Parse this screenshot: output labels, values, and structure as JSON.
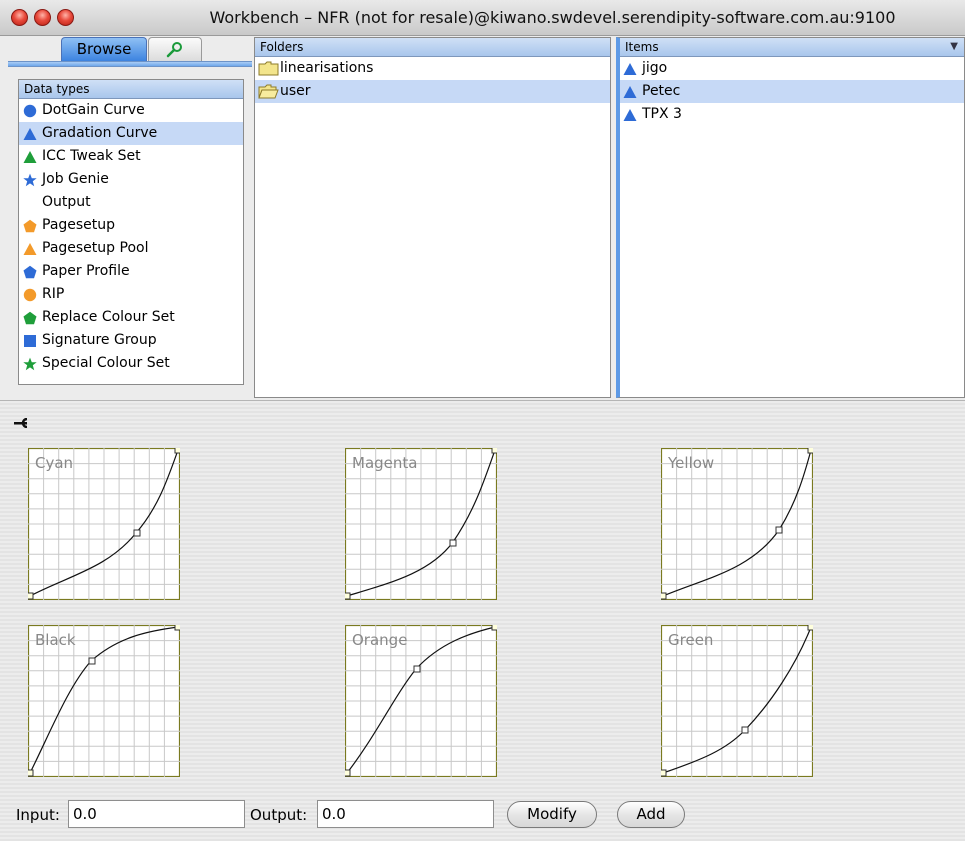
{
  "window": {
    "title": "Workbench – NFR (not for resale)@kiwano.swdevel.serendipity-software.com.au:9100"
  },
  "tabs": {
    "browse_label": "Browse",
    "search_icon": "magnifier-icon"
  },
  "datatypes": {
    "header": "Data types",
    "items": [
      {
        "label": "DotGain Curve",
        "icon": "circle",
        "color": "#2e6bd6"
      },
      {
        "label": "Gradation Curve",
        "icon": "triangle",
        "color": "#2e6bd6"
      },
      {
        "label": "ICC Tweak Set",
        "icon": "triangle",
        "color": "#1f9e3a"
      },
      {
        "label": "Job Genie",
        "icon": "star",
        "color": "#2e6bd6"
      },
      {
        "label": "Output",
        "icon": "crescent",
        "color": "#f39a2a"
      },
      {
        "label": "Pagesetup",
        "icon": "pentagon",
        "color": "#f39a2a"
      },
      {
        "label": "Pagesetup Pool",
        "icon": "triangle",
        "color": "#f39a2a"
      },
      {
        "label": "Paper Profile",
        "icon": "pentagon",
        "color": "#2e6bd6"
      },
      {
        "label": "RIP",
        "icon": "circle",
        "color": "#f39a2a"
      },
      {
        "label": "Replace Colour Set",
        "icon": "pentagon",
        "color": "#1f9e3a"
      },
      {
        "label": "Signature Group",
        "icon": "square",
        "color": "#2e6bd6"
      },
      {
        "label": "Special Colour Set",
        "icon": "star",
        "color": "#1f9e3a"
      }
    ]
  },
  "folders": {
    "header": "Folders",
    "items": [
      {
        "label": "linearisations"
      },
      {
        "label": "user"
      }
    ]
  },
  "items": {
    "header": "Items",
    "list": [
      {
        "label": "jigo"
      },
      {
        "label": "Petec"
      },
      {
        "label": "TPX 3"
      }
    ]
  },
  "curves": [
    {
      "label": "Cyan"
    },
    {
      "label": "Magenta"
    },
    {
      "label": "Yellow"
    },
    {
      "label": "Black"
    },
    {
      "label": "Orange"
    },
    {
      "label": "Green"
    }
  ],
  "controls": {
    "input_label": "Input:",
    "input_value": "0.0",
    "output_label": "Output:",
    "output_value": "0.0",
    "modify_label": "Modify",
    "add_label": "Add"
  }
}
